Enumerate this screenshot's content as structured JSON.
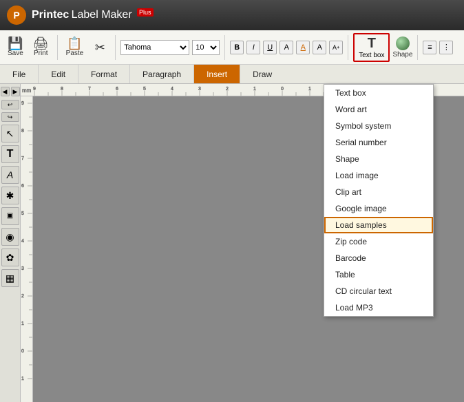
{
  "app": {
    "logo": "P",
    "title_bold": "Printec",
    "title_normal": " Label Maker",
    "plus": "Plus"
  },
  "toolbar": {
    "save_label": "Save",
    "print_label": "Print",
    "paste_label": "Paste",
    "font_name": "Tahoma",
    "font_size": "10",
    "textbox_label": "Text box",
    "shape_label": "Shape"
  },
  "menubar": {
    "items": [
      "File",
      "Edit",
      "Format",
      "Paragraph",
      "Insert",
      "Draw"
    ]
  },
  "left_toolbar": {
    "tools": [
      "↖",
      "A",
      "A",
      "✱",
      "▣",
      "◉",
      "✿",
      "▦"
    ]
  },
  "dropdown": {
    "items": [
      {
        "label": "Text box",
        "highlighted": false
      },
      {
        "label": "Word art",
        "highlighted": false
      },
      {
        "label": "Symbol system",
        "highlighted": false
      },
      {
        "label": "Serial number",
        "highlighted": false
      },
      {
        "label": "Shape",
        "highlighted": false
      },
      {
        "label": "Load image",
        "highlighted": false
      },
      {
        "label": "Clip art",
        "highlighted": false
      },
      {
        "label": "Google image",
        "highlighted": false
      },
      {
        "label": "Load samples",
        "highlighted": true
      },
      {
        "label": "Zip code",
        "highlighted": false
      },
      {
        "label": "Barcode",
        "highlighted": false
      },
      {
        "label": "Table",
        "highlighted": false
      },
      {
        "label": "CD  circular text",
        "highlighted": false
      },
      {
        "label": "Load MP3",
        "highlighted": false
      }
    ]
  }
}
